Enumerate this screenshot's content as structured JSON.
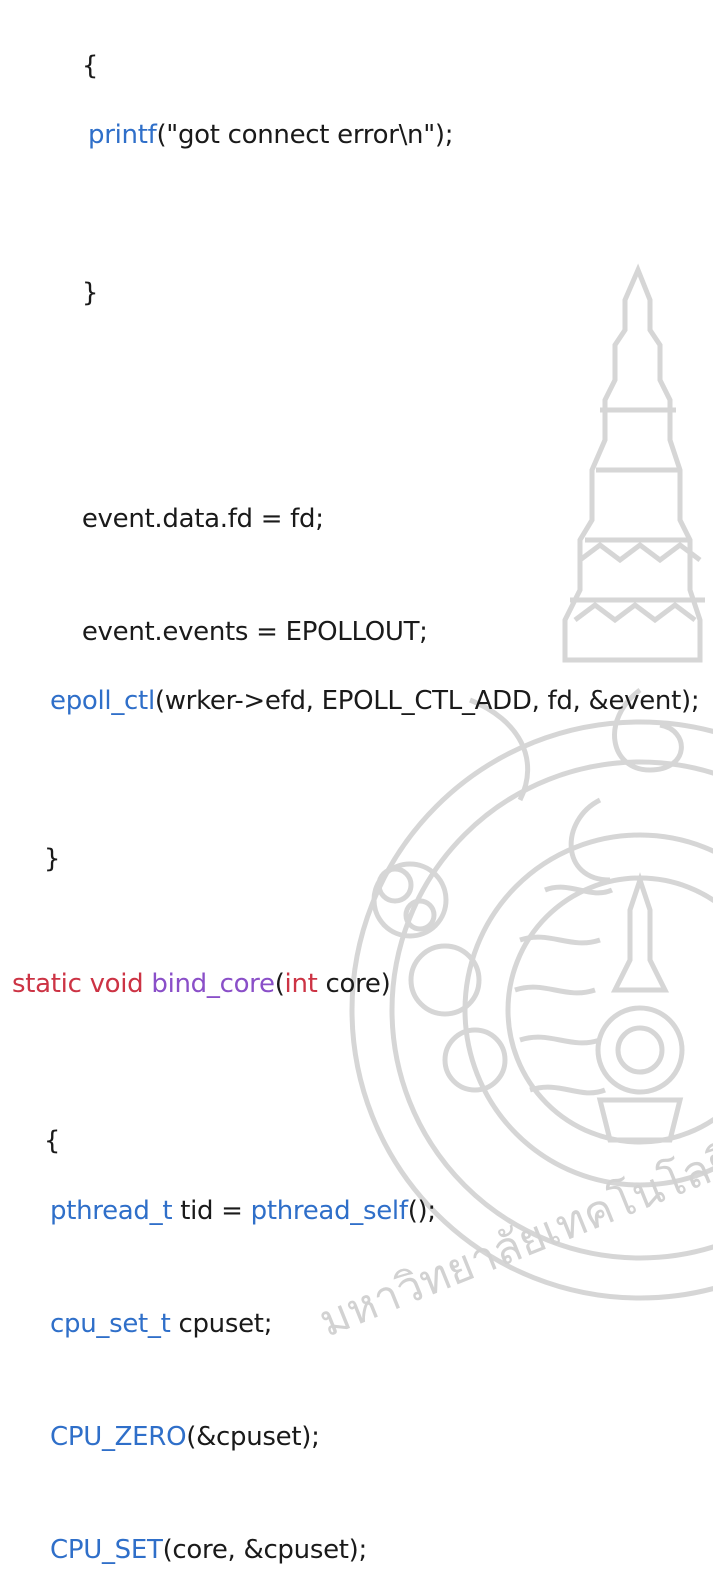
{
  "code": {
    "l1": "{",
    "l2_fn": "printf",
    "l2_rest": "(\"got connect error\\n\");",
    "l3": "}",
    "l4": "event.data.fd = fd;",
    "l5": "event.events = EPOLLOUT;",
    "l6_fn": "epoll_ctl",
    "l6_rest": "(wrker->efd, EPOLL_CTL_ADD, fd, &event);",
    "l7": "}",
    "l8_kw1": "static",
    "l8_kw2": "void",
    "l8_fn": "bind_core",
    "l8_p1": "(",
    "l8_kw3": "int",
    "l8_p2": " core)",
    "l9": "{",
    "l10_fn1": "pthread_t",
    "l10_mid": " tid = ",
    "l10_fn2": "pthread_self",
    "l10_end": "();",
    "l11_fn": "cpu_set_t",
    "l11_rest": " cpuset;",
    "l12_fn": "CPU_ZERO",
    "l12_rest": "(&cpuset);",
    "l13_fn": "CPU_SET",
    "l13_rest": "(core, &cpuset);"
  },
  "watermark": {
    "emblem": "university-seal",
    "text": "มหาวิทยาลัยเทคโนโลยีรา"
  },
  "colors": {
    "function": "#2f6fc9",
    "keyword": "#cc3344",
    "type": "#8a4fc8",
    "text": "#1a1a1a",
    "watermark": "#cfcfcf"
  }
}
